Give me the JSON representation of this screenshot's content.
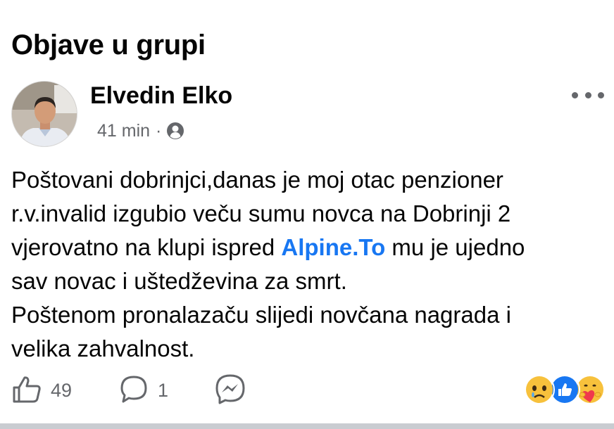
{
  "section": {
    "title": "Objave u grupi"
  },
  "post": {
    "author": "Elvedin Elko",
    "time": "41 min",
    "separator": "·",
    "body": {
      "line1": "Poštovani dobrinjci,danas je moj otac penzioner",
      "line2": "r.v.invalid izgubio veču sumu novca na Dobrinji 2",
      "line3_before": "vjerovatno na klupi ispred ",
      "line3_link": "Alpine.To",
      "line3_after": " mu je ujedno",
      "line4": "sav novac i uštedževina za smrt.",
      "line5": "Poštenom pronalazaču slijedi novčana nagrada i",
      "line6": "velika zahvalnost."
    },
    "likes": "49",
    "comments": "1"
  },
  "icons": {
    "privacy": "group-members-icon",
    "more": "more-options-icon",
    "like": "thumbs-up-icon",
    "comment": "comment-icon",
    "share": "messenger-icon",
    "reactions": [
      "sad-reaction-icon",
      "like-reaction-icon",
      "care-reaction-icon"
    ]
  },
  "colors": {
    "link": "#1877f2",
    "meta": "#65676b",
    "like_blue": "#1877f2"
  }
}
